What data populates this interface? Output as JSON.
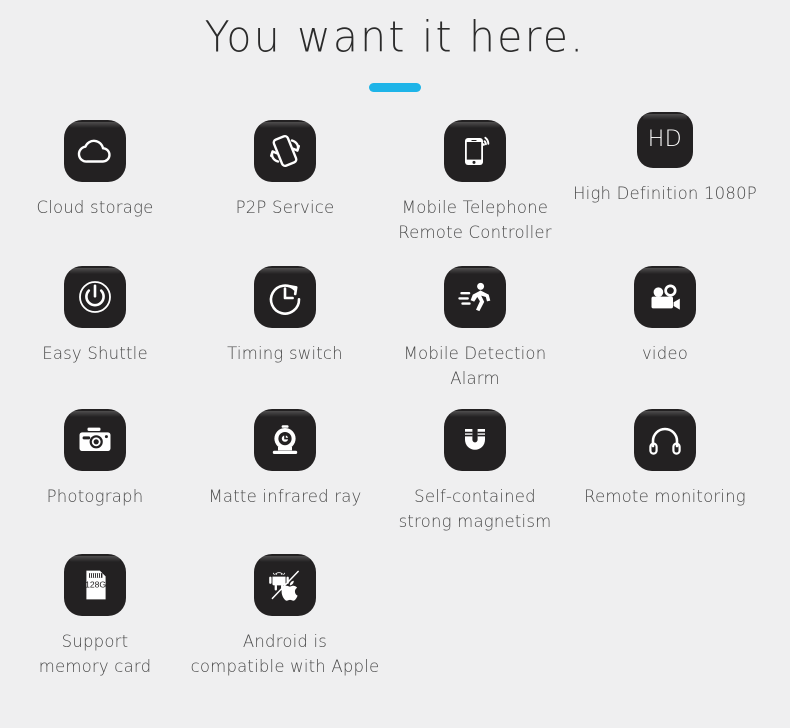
{
  "header": {
    "title": "You want it here.",
    "accent_color": "#1eb4e8"
  },
  "theme": {
    "background": "#efeff0",
    "icon_background": "#232122",
    "icon_glyph": "#ffffff",
    "label_color": "#4a4a4a"
  },
  "features": [
    [
      {
        "icon": "cloud-icon",
        "label": "Cloud storage"
      },
      {
        "icon": "p2p-devices-icon",
        "label": "P2P Service"
      },
      {
        "icon": "phone-wifi-icon",
        "label": "Mobile Telephone\nRemote Controller"
      },
      {
        "icon": "hd-badge-icon",
        "label": "High Definition 1080P",
        "badge_text": "HD"
      }
    ],
    [
      {
        "icon": "power-icon",
        "label": "Easy Shuttle"
      },
      {
        "icon": "clock-refresh-icon",
        "label": "Timing switch"
      },
      {
        "icon": "running-person-icon",
        "label": "Mobile Detection Alarm"
      },
      {
        "icon": "movie-camera-icon",
        "label": "video"
      }
    ],
    [
      {
        "icon": "photo-camera-icon",
        "label": "Photograph"
      },
      {
        "icon": "webcam-icon",
        "label": "Matte infrared ray"
      },
      {
        "icon": "magnet-icon",
        "label": "Self-contained\nstrong magnetism"
      },
      {
        "icon": "headphones-icon",
        "label": "Remote monitoring"
      }
    ],
    [
      {
        "icon": "memory-card-icon",
        "label": "Support\nmemory card",
        "badge_text": "128G"
      },
      {
        "icon": "android-apple-icon",
        "label": "Android is\ncompatible  with Apple"
      }
    ]
  ]
}
